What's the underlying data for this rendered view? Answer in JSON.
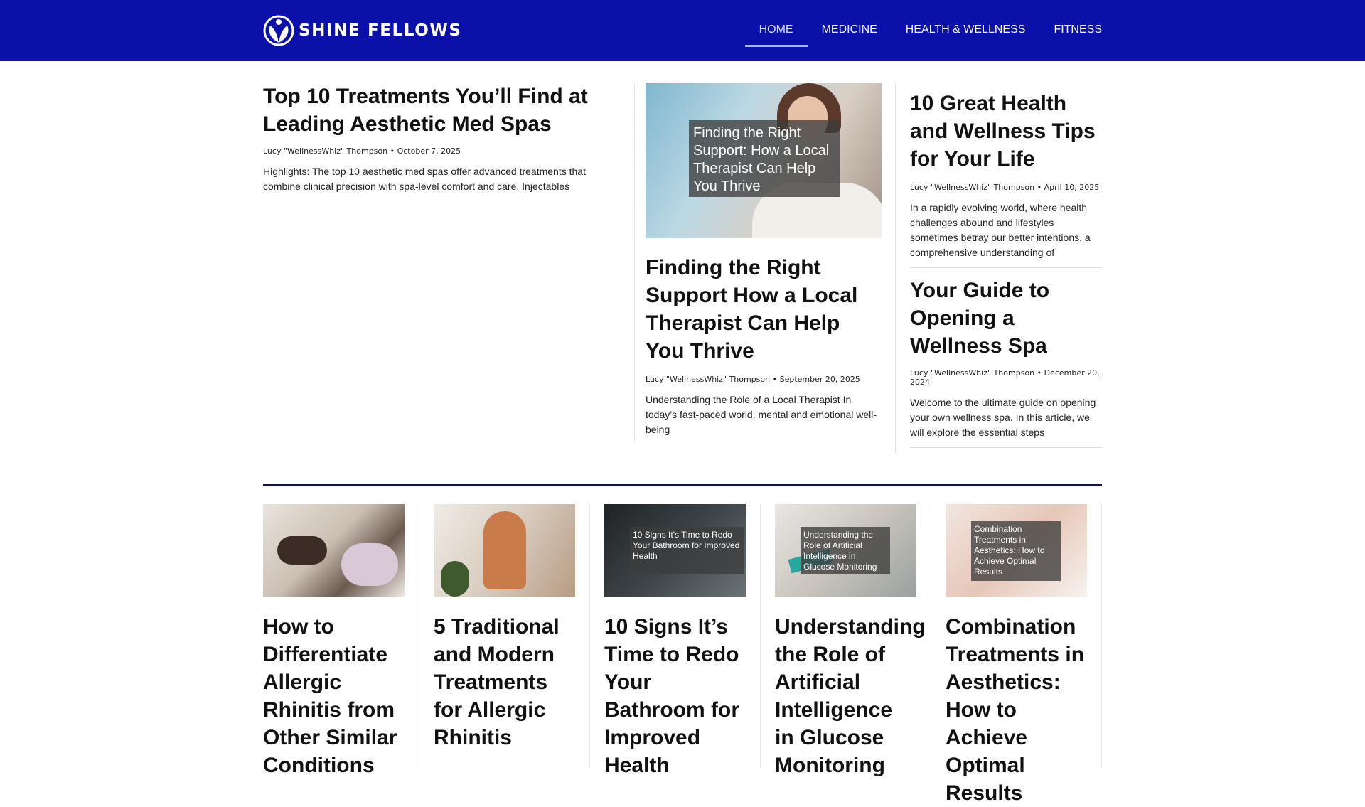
{
  "brand": {
    "name": "SHINE FELLOWS",
    "logo_icon": "leaf-person-logo-icon",
    "header_color": "#0b11a8"
  },
  "nav": [
    {
      "label": "HOME",
      "active": true
    },
    {
      "label": "MEDICINE"
    },
    {
      "label": "HEALTH & WELLNESS"
    },
    {
      "label": "FITNESS"
    }
  ],
  "featured": {
    "left": {
      "title": "Top 10 Treatments You’ll Find at Leading Aesthetic Med Spas",
      "meta": "Lucy \"WellnessWhiz\" Thompson • October 7, 2025",
      "excerpt": "Highlights: The top 10 aesthetic med spas offer advanced treatments that combine clinical precision with spa-level comfort and care. Injectables"
    },
    "middle": {
      "image_caption": "Finding the Right Support: How a Local Therapist Can Help You Thrive",
      "title": "Finding the Right Support How a Local Therapist Can Help You Thrive",
      "meta": "Lucy \"WellnessWhiz\" Thompson • September 20, 2025",
      "excerpt": "Understanding the Role of a Local Therapist In today’s fast-paced world, mental and emotional well-being"
    },
    "right": [
      {
        "title": "10 Great Health and Wellness Tips for Your Life",
        "meta": "Lucy \"WellnessWhiz\" Thompson • April 10, 2025",
        "excerpt": "In a rapidly evolving world, where health challenges abound and lifestyles sometimes betray our better intentions, a comprehensive understanding of"
      },
      {
        "title": "Your Guide to Opening a Wellness Spa",
        "meta": "Lucy \"WellnessWhiz\" Thompson • December 20, 2024",
        "excerpt": "Welcome to the ultimate guide on opening your own wellness spa. In this article, we will explore the essential steps"
      }
    ]
  },
  "cards": [
    {
      "title": "How to Differentiate Allergic Rhinitis from Other Similar Conditions",
      "image_caption": ""
    },
    {
      "title": "5 Traditional and Modern Treatments for Allergic Rhinitis",
      "image_caption": ""
    },
    {
      "title": "10 Signs It’s Time to Redo Your Bathroom for Improved Health",
      "image_caption": "10 Signs It's Time to Redo Your Bathroom for Improved Health"
    },
    {
      "title": "Understanding the Role of Artificial Intelligence in Glucose Monitoring",
      "image_caption": "Understanding the Role of Artificial Intelligence in Glucose Monitoring"
    },
    {
      "title": "Combination Treatments in Aesthetics: How to Achieve Optimal Results",
      "image_caption": "Combination Treatments in Aesthetics: How to Achieve Optimal Results"
    }
  ]
}
